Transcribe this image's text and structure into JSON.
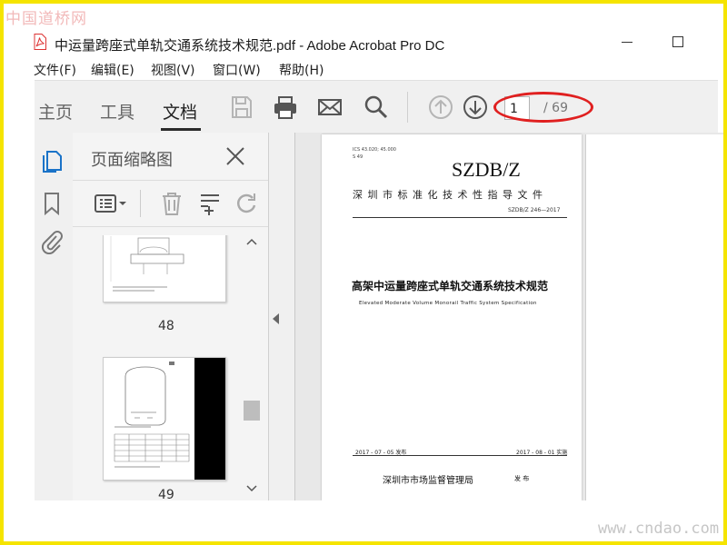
{
  "watermarks": {
    "top": "中国道桥网",
    "bottom": "www.cndao.com"
  },
  "window": {
    "title": "中运量跨座式单轨交通系统技术规范.pdf - Adobe Acrobat Pro DC",
    "file_icon": "pdf-file-icon"
  },
  "menu": {
    "items": [
      {
        "label": "文件(F)"
      },
      {
        "label": "编辑(E)"
      },
      {
        "label": "视图(V)"
      },
      {
        "label": "窗口(W)"
      },
      {
        "label": "帮助(H)"
      }
    ]
  },
  "toolbar": {
    "tabs": [
      {
        "label": "主页",
        "active": false
      },
      {
        "label": "工具",
        "active": false
      },
      {
        "label": "文档",
        "active": true
      }
    ],
    "icons": [
      "save-icon",
      "print-icon",
      "email-icon",
      "search-icon",
      "page-up-icon",
      "page-down-icon"
    ],
    "page": {
      "current": "1",
      "total": "/ 69"
    },
    "highlight_color": "#e02020"
  },
  "left_strip": {
    "icons": [
      "page-thumbnails-icon",
      "bookmark-icon",
      "attachment-icon"
    ],
    "active_color": "#1a73c8"
  },
  "thumb_panel": {
    "title": "页面缩略图",
    "tools": [
      "thumbnail-options-icon",
      "delete-page-icon",
      "insert-page-icon",
      "rotate-page-icon"
    ],
    "pages": [
      {
        "number": "48"
      },
      {
        "number": "49"
      }
    ]
  },
  "document": {
    "page1": {
      "ics": "ICS 43.020; 45.000",
      "class": "S 49",
      "code": "SZDB/Z",
      "body": "深 圳 市 标 准 化 技 术 性 指 导 文 件",
      "standard_no": "SZDB/Z 246—2017",
      "title_cn": "高架中运量跨座式单轨交通系统技术规范",
      "title_en": "Elevated Moderate Volume Monorail Traffic System Specification",
      "issue_date": "2017 - 07 - 05 发布",
      "impl_date": "2017 - 08 - 01 实施",
      "issuer": "深圳市市场监督管理局",
      "issue_word": "发 布"
    }
  }
}
